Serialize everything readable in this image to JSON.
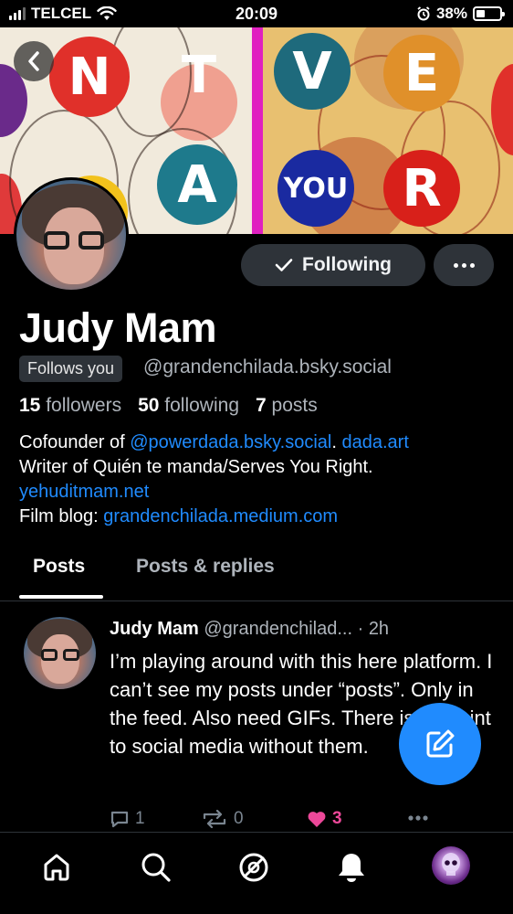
{
  "status_bar": {
    "carrier": "TELCEL",
    "time": "20:09",
    "battery_percent": "38%",
    "battery_level": 0.38,
    "icons": [
      "signal-icon",
      "wifi-icon",
      "alarm-icon",
      "battery-icon"
    ]
  },
  "banner": {
    "letters_left": [
      "N",
      "T",
      "A"
    ],
    "letters_right": [
      "V",
      "E",
      "YOU",
      "R"
    ],
    "back_icon": "chevron-left-icon"
  },
  "profile": {
    "display_name": "Judy Mam",
    "follows_you": "Follows you",
    "handle": "@grandenchilada.bsky.social",
    "following_button": "Following",
    "followers_count": "15",
    "followers_label": "followers",
    "following_count": "50",
    "following_label": "following",
    "posts_count": "7",
    "posts_label": "posts",
    "bio": {
      "line1_prefix": "Cofounder of ",
      "line1_link1": "@powerdada.bsky.social",
      "line1_sep": ". ",
      "line1_link2": "dada.art",
      "line2": "Writer of Quién te manda/Serves You Right.",
      "line3_link": "yehuditmam.net",
      "line4_prefix": "Film blog: ",
      "line4_link": "grandenchilada.medium.com"
    }
  },
  "tabs": [
    {
      "label": "Posts",
      "active": true
    },
    {
      "label": "Posts & replies",
      "active": false
    }
  ],
  "post": {
    "author": "Judy Mam",
    "handle": "@grandenchilad...",
    "time_sep": "·",
    "time": "2h",
    "text": "I’m playing around with this here platform. I can’t see my posts under “posts”. Only in the feed. Also need GIFs. There is no point to social media without them.",
    "reply_count": "1",
    "repost_count": "0",
    "like_count": "3",
    "liked": true
  },
  "bottom_nav": {
    "items": [
      "home-icon",
      "search-icon",
      "feeds-icon",
      "notifications-icon",
      "profile-avatar"
    ]
  },
  "colors": {
    "background": "#000000",
    "accent": "#208bfe",
    "like": "#ec4899",
    "secondary_text": "#aeb4bb",
    "button_bg": "#2e3339"
  }
}
